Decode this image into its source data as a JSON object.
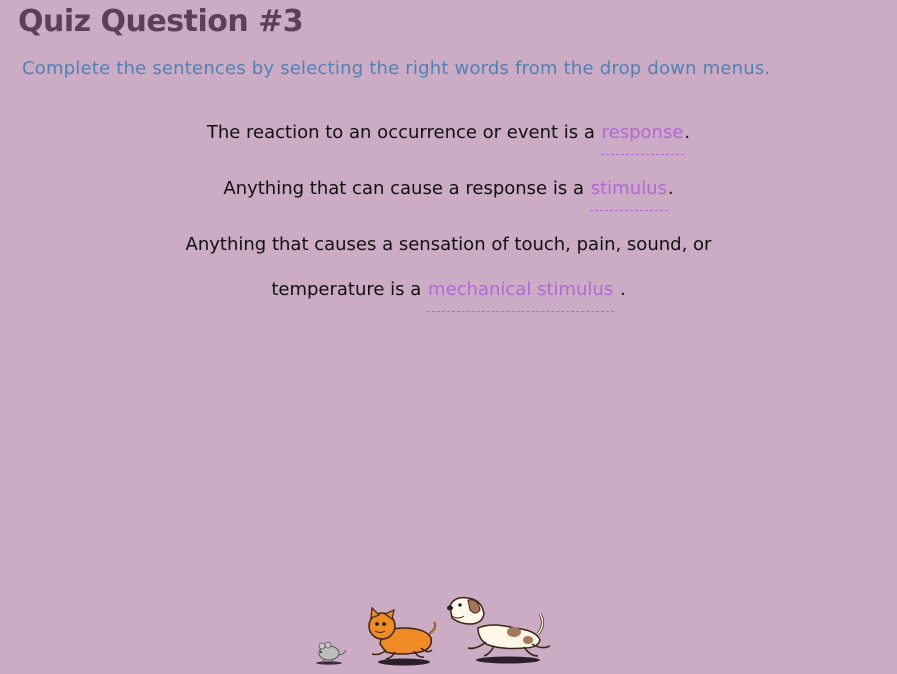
{
  "title": "Quiz Question #3",
  "instructions": "Complete the sentences by selecting the right words from the drop down menus.",
  "sentences": [
    {
      "before": "The reaction to an occurrence or event is a",
      "answer": "response",
      "after": "."
    },
    {
      "before": "Anything that can cause a response is a",
      "answer": "stimulus",
      "after": "."
    },
    {
      "line1": "Anything that causes a sensation of touch, pain, sound, or",
      "before": "temperature is a",
      "answer": "mechanical stimulus",
      "after": "."
    }
  ],
  "colors": {
    "background": "#ccabc5",
    "title": "#5e3f5b",
    "instructions": "#4e82b4",
    "dropdown": "#b268d6",
    "moon": "#f2c316",
    "cat": "#f08a24"
  },
  "icons": [
    "moon-icon",
    "mouse-icon",
    "cat-icon",
    "dog-icon"
  ]
}
